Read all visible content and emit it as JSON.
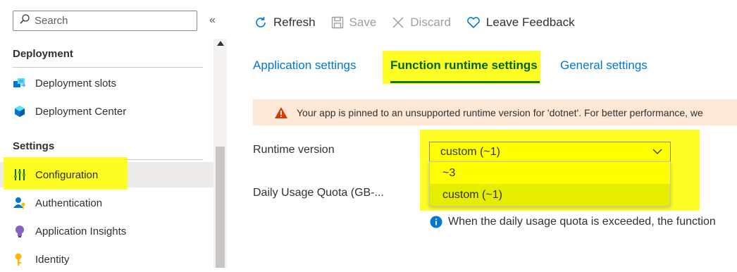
{
  "sidebar": {
    "search_placeholder": "Search",
    "collapse_glyph": "«",
    "sections": [
      {
        "title": "Deployment",
        "items": [
          {
            "label": "Deployment slots",
            "icon": "deployment-slots-icon"
          },
          {
            "label": "Deployment Center",
            "icon": "cube-icon"
          }
        ]
      },
      {
        "title": "Settings",
        "items": [
          {
            "label": "Configuration",
            "icon": "configuration-icon",
            "active": true
          },
          {
            "label": "Authentication",
            "icon": "user-key-icon"
          },
          {
            "label": "Application Insights",
            "icon": "lightbulb-icon"
          },
          {
            "label": "Identity",
            "icon": "key-icon"
          }
        ]
      }
    ]
  },
  "toolbar": {
    "refresh": "Refresh",
    "save": "Save",
    "discard": "Discard",
    "feedback": "Leave Feedback"
  },
  "tabs": [
    {
      "label": "Application settings"
    },
    {
      "label": "Function runtime settings",
      "active": true
    },
    {
      "label": "General settings"
    }
  ],
  "warning": {
    "text": "Your app is pinned to an unsupported runtime version for 'dotnet'. For better performance, we"
  },
  "form": {
    "runtime_label": "Runtime version",
    "runtime_value": "custom (~1)",
    "runtime_options": [
      "~3",
      "custom (~1)"
    ],
    "quota_label": "Daily Usage Quota (GB-...",
    "quota_info": "When the daily usage quota is exceeded, the function"
  },
  "colors": {
    "accent": "#0078d4",
    "active_tab": "#107c10",
    "highlight": "#ffff00",
    "warning_bg": "#fde7d6"
  }
}
